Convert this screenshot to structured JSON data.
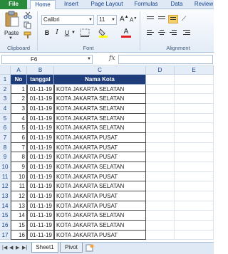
{
  "ribbon_tabs": [
    "File",
    "Home",
    "Insert",
    "Page Layout",
    "Formulas",
    "Data",
    "Review"
  ],
  "ribbon": {
    "paste_label": "Paste",
    "font_name": "Calibri",
    "font_size": "11",
    "bold": "B",
    "italic": "I",
    "underline": "U",
    "groups": {
      "clipboard": "Clipboard",
      "font": "Font",
      "alignment": "Alignment"
    },
    "accent": "#2a8a3c",
    "highlight_color": "#ffff00",
    "font_color": "#e02020"
  },
  "formula_bar": {
    "cell_ref": "F6",
    "fx": "fx",
    "content": ""
  },
  "columns": [
    "A",
    "B",
    "C",
    "D",
    "E"
  ],
  "table": {
    "headers": [
      "No",
      "tanggal",
      "Nama Kota"
    ],
    "header_color": "#1f3d7a",
    "rows": [
      [
        "1",
        "01-11-19",
        "KOTA JAKARTA SELATAN"
      ],
      [
        "2",
        "01-11-19",
        "KOTA JAKARTA SELATAN"
      ],
      [
        "3",
        "01-11-19",
        "KOTA JAKARTA SELATAN"
      ],
      [
        "4",
        "01-11-19",
        "KOTA JAKARTA SELATAN"
      ],
      [
        "5",
        "01-11-19",
        "KOTA JAKARTA SELATAN"
      ],
      [
        "6",
        "01-11-19",
        "KOTA JAKARTA PUSAT"
      ],
      [
        "7",
        "01-11-19",
        "KOTA JAKARTA PUSAT"
      ],
      [
        "8",
        "01-11-19",
        "KOTA JAKARTA PUSAT"
      ],
      [
        "9",
        "01-11-19",
        "KOTA JAKARTA SELATAN"
      ],
      [
        "10",
        "01-11-19",
        "KOTA JAKARTA PUSAT"
      ],
      [
        "11",
        "01-11-19",
        "KOTA JAKARTA SELATAN"
      ],
      [
        "12",
        "01-11-19",
        "KOTA JAKARTA PUSAT"
      ],
      [
        "13",
        "01-11-19",
        "KOTA JAKARTA PUSAT"
      ],
      [
        "14",
        "01-11-19",
        "KOTA JAKARTA SELATAN"
      ],
      [
        "15",
        "01-11-19",
        "KOTA JAKARTA SELATAN"
      ],
      [
        "16",
        "01-11-19",
        "KOTA JAKARTA PUSAT"
      ]
    ]
  },
  "row_numbers": [
    "1",
    "2",
    "3",
    "4",
    "5",
    "6",
    "7",
    "8",
    "9",
    "10",
    "11",
    "12",
    "13",
    "14",
    "15",
    "16",
    "17"
  ],
  "sheets": [
    "Sheet1",
    "Pivot"
  ]
}
